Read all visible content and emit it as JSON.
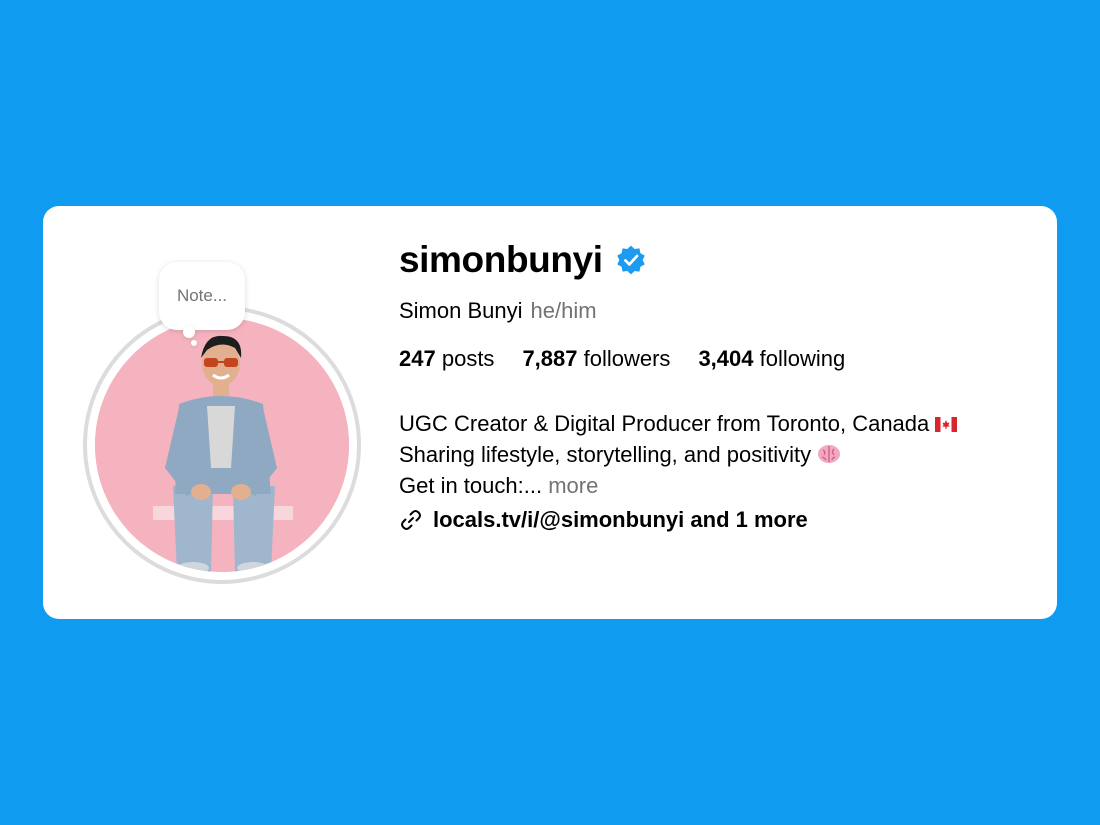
{
  "profile": {
    "username": "simonbunyi",
    "full_name": "Simon Bunyi",
    "pronouns": "he/him",
    "note_placeholder": "Note...",
    "verified_icon": "verified-badge-icon",
    "stats": [
      {
        "value": "247",
        "label": "posts"
      },
      {
        "value": "7,887",
        "label": "followers"
      },
      {
        "value": "3,404",
        "label": "following"
      }
    ],
    "bio": {
      "line1": "UGC Creator & Digital Producer from Toronto, Canada",
      "line1_emoji": "canada-flag-icon",
      "line2": "Sharing lifestyle, storytelling, and positivity",
      "line2_emoji": "brain-icon",
      "line3": "Get in touch:...",
      "more_label": "more"
    },
    "link": {
      "text": "locals.tv/i/@simonbunyi and 1 more",
      "icon": "link-icon"
    }
  },
  "colors": {
    "background": "#0f9cf0",
    "card": "#ffffff",
    "verified": "#1d9bf0",
    "muted": "#737373",
    "avatar_bg": "#f4b3bf"
  }
}
